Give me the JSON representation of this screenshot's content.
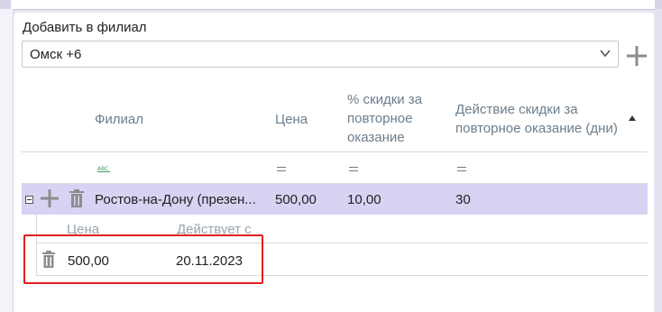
{
  "add_branch": {
    "label": "Добавить в филиал",
    "selected_value": "Омск +6"
  },
  "grid": {
    "columns": [
      "Филиал",
      "Цена",
      "% скидки за повторное оказание",
      "Действие скидки за повторное оказание (дни)"
    ],
    "sort": "ascending",
    "rows": [
      {
        "branch": "Ростов-на-Дону (презен...",
        "price": "500,00",
        "discount": "10,00",
        "discount_days": "30",
        "expanded": true,
        "sub_table": {
          "columns": [
            "Цена",
            "Действует с"
          ],
          "rows": [
            {
              "price": "500,00",
              "valid_from": "20.11.2023"
            }
          ]
        }
      }
    ]
  },
  "colors": {
    "selected_row": "#d7d3f3",
    "highlight_border": "#e01e1e",
    "header_text": "#6b7d8c"
  },
  "icons": [
    "chevron-down-icon",
    "plus-icon",
    "trash-icon",
    "abc-filter-icon",
    "equals-filter-icon",
    "collapse-icon",
    "sort-ascending-icon"
  ]
}
